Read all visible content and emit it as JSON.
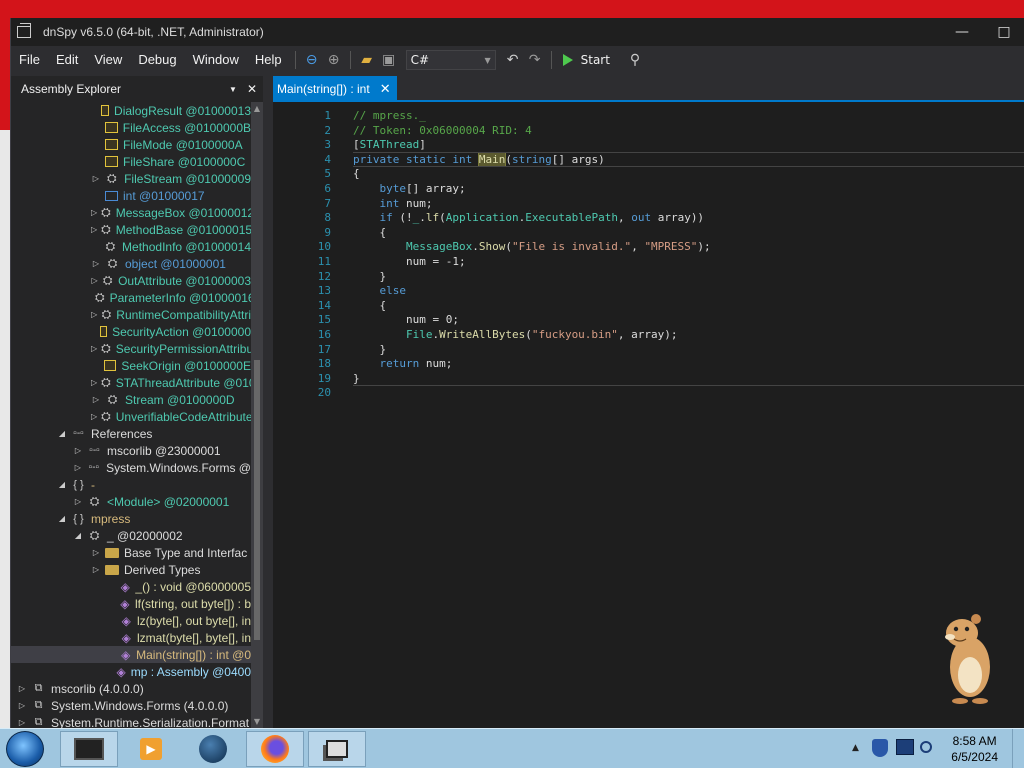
{
  "window": {
    "title": "dnSpy v6.5.0 (64-bit, .NET, Administrator)",
    "minimize_glyph": "—",
    "maximize_glyph": "□"
  },
  "menu": {
    "items": [
      "File",
      "Edit",
      "View",
      "Debug",
      "Window",
      "Help"
    ]
  },
  "toolbar": {
    "language": "C#",
    "start_label": "Start"
  },
  "explorer": {
    "title": "Assembly Explorer",
    "nodes": [
      {
        "text": "DialogResult @01000013",
        "kind": "enum",
        "indent": 3,
        "expander": "",
        "style": "type"
      },
      {
        "text": "FileAccess @0100000B",
        "kind": "enum",
        "indent": 3,
        "expander": "",
        "style": "type"
      },
      {
        "text": "FileMode @0100000A",
        "kind": "enum",
        "indent": 3,
        "expander": "",
        "style": "type"
      },
      {
        "text": "FileShare @0100000C",
        "kind": "enum",
        "indent": 3,
        "expander": "",
        "style": "type"
      },
      {
        "text": "FileStream @01000009",
        "kind": "class",
        "indent": 3,
        "expander": "▷",
        "style": "type"
      },
      {
        "text": "int @01000017",
        "kind": "struct",
        "indent": 3,
        "expander": "",
        "style": "kw"
      },
      {
        "text": "MessageBox @01000012",
        "kind": "class",
        "indent": 3,
        "expander": "▷",
        "style": "type"
      },
      {
        "text": "MethodBase @01000015",
        "kind": "class",
        "indent": 3,
        "expander": "▷",
        "style": "type"
      },
      {
        "text": "MethodInfo @01000014",
        "kind": "class",
        "indent": 3,
        "expander": "",
        "style": "type"
      },
      {
        "text": "object @01000001",
        "kind": "class",
        "indent": 3,
        "expander": "▷",
        "style": "kw"
      },
      {
        "text": "OutAttribute @01000003",
        "kind": "class",
        "indent": 3,
        "expander": "▷",
        "style": "type"
      },
      {
        "text": "ParameterInfo @01000016",
        "kind": "class",
        "indent": 3,
        "expander": "",
        "style": "type"
      },
      {
        "text": "RuntimeCompatibilityAttri",
        "kind": "class",
        "indent": 3,
        "expander": "▷",
        "style": "type"
      },
      {
        "text": "SecurityAction @0100000",
        "kind": "enum",
        "indent": 3,
        "expander": "",
        "style": "type"
      },
      {
        "text": "SecurityPermissionAttribu",
        "kind": "class",
        "indent": 3,
        "expander": "▷",
        "style": "type"
      },
      {
        "text": "SeekOrigin @0100000E",
        "kind": "enum",
        "indent": 3,
        "expander": "",
        "style": "type"
      },
      {
        "text": "STAThreadAttribute @010",
        "kind": "class",
        "indent": 3,
        "expander": "▷",
        "style": "type"
      },
      {
        "text": "Stream @0100000D",
        "kind": "class",
        "indent": 3,
        "expander": "▷",
        "style": "type"
      },
      {
        "text": "UnverifiableCodeAttribute",
        "kind": "class",
        "indent": 3,
        "expander": "▷",
        "style": "type"
      },
      {
        "text": "References",
        "kind": "ref",
        "indent": 1,
        "expander": "◢",
        "style": "plain"
      },
      {
        "text": "mscorlib @23000001",
        "kind": "ref",
        "indent": 2,
        "expander": "▷",
        "style": "plain"
      },
      {
        "text": "System.Windows.Forms @",
        "kind": "ref",
        "indent": 2,
        "expander": "▷",
        "style": "plain"
      },
      {
        "text": "-",
        "kind": "ns",
        "indent": 1,
        "expander": "◢",
        "style": "ns"
      },
      {
        "text": "<Module> @02000001",
        "kind": "class",
        "indent": 2,
        "expander": "▷",
        "style": "type"
      },
      {
        "text": "mpress",
        "kind": "ns",
        "indent": 1,
        "expander": "◢",
        "style": "ns"
      },
      {
        "text": "_ @02000002",
        "kind": "class",
        "indent": 2,
        "expander": "◢",
        "style": "plain"
      },
      {
        "text": "Base Type and Interfac",
        "kind": "folder",
        "indent": 3,
        "expander": "▷",
        "style": "plain"
      },
      {
        "text": "Derived Types",
        "kind": "folder",
        "indent": 3,
        "expander": "▷",
        "style": "plain"
      },
      {
        "text": "_() : void @06000005",
        "kind": "method",
        "indent": 4,
        "expander": "",
        "style": "method"
      },
      {
        "text": "lf(string, out byte[]) : b",
        "kind": "method",
        "indent": 4,
        "expander": "",
        "style": "method"
      },
      {
        "text": "lz(byte[], out byte[], in",
        "kind": "method",
        "indent": 4,
        "expander": "",
        "style": "method"
      },
      {
        "text": "lzmat(byte[], byte[], in",
        "kind": "method",
        "indent": 4,
        "expander": "",
        "style": "method"
      },
      {
        "text": "Main(string[]) : int @0",
        "kind": "method",
        "indent": 4,
        "expander": "",
        "style": "sel"
      },
      {
        "text": "mp : Assembly @0400",
        "kind": "field",
        "indent": 4,
        "expander": "",
        "style": "field"
      },
      {
        "text": "mscorlib (4.0.0.0)",
        "kind": "asm",
        "indent": 0,
        "expander": "▷",
        "style": "plain"
      },
      {
        "text": "System.Windows.Forms (4.0.0.0)",
        "kind": "asm",
        "indent": 0,
        "expander": "▷",
        "style": "plain"
      },
      {
        "text": "System.Runtime.Serialization.Format",
        "kind": "asm",
        "indent": 0,
        "expander": "▷",
        "style": "plain"
      }
    ]
  },
  "tab": {
    "label": "Main(string[]) : int",
    "close": "✕"
  },
  "code": {
    "lines": [
      [
        {
          "t": "// mpress._",
          "c": "com"
        }
      ],
      [
        {
          "t": "// Token: 0x06000004 RID: 4",
          "c": "com"
        }
      ],
      [
        {
          "t": "[",
          "c": ""
        },
        {
          "t": "STAThread",
          "c": "type"
        },
        {
          "t": "]",
          "c": ""
        }
      ],
      [
        {
          "t": "private static int ",
          "c": "kw"
        },
        {
          "t": "Main",
          "c": "hl"
        },
        {
          "t": "(",
          "c": ""
        },
        {
          "t": "string",
          "c": "kw"
        },
        {
          "t": "[] args)",
          "c": ""
        }
      ],
      [
        {
          "t": "{",
          "c": ""
        }
      ],
      [
        {
          "t": "    ",
          "c": ""
        },
        {
          "t": "byte",
          "c": "kw"
        },
        {
          "t": "[] array;",
          "c": ""
        }
      ],
      [
        {
          "t": "    ",
          "c": ""
        },
        {
          "t": "int",
          "c": "kw"
        },
        {
          "t": " num;",
          "c": ""
        }
      ],
      [
        {
          "t": "    ",
          "c": ""
        },
        {
          "t": "if",
          "c": "kw"
        },
        {
          "t": " (!",
          "c": ""
        },
        {
          "t": "_",
          "c": "type"
        },
        {
          "t": ".",
          "c": ""
        },
        {
          "t": "lf",
          "c": "method"
        },
        {
          "t": "(",
          "c": ""
        },
        {
          "t": "Application",
          "c": "type"
        },
        {
          "t": ".",
          "c": ""
        },
        {
          "t": "ExecutablePath",
          "c": "type"
        },
        {
          "t": ", ",
          "c": ""
        },
        {
          "t": "out",
          "c": "kw"
        },
        {
          "t": " array))",
          "c": ""
        }
      ],
      [
        {
          "t": "    {",
          "c": ""
        }
      ],
      [
        {
          "t": "        ",
          "c": ""
        },
        {
          "t": "MessageBox",
          "c": "type"
        },
        {
          "t": ".",
          "c": ""
        },
        {
          "t": "Show",
          "c": "method"
        },
        {
          "t": "(",
          "c": ""
        },
        {
          "t": "\"File is invalid.\"",
          "c": "str"
        },
        {
          "t": ", ",
          "c": ""
        },
        {
          "t": "\"MPRESS\"",
          "c": "str"
        },
        {
          "t": ");",
          "c": ""
        }
      ],
      [
        {
          "t": "        num = -1;",
          "c": ""
        }
      ],
      [
        {
          "t": "    }",
          "c": ""
        }
      ],
      [
        {
          "t": "    ",
          "c": ""
        },
        {
          "t": "else",
          "c": "kw"
        }
      ],
      [
        {
          "t": "    {",
          "c": ""
        }
      ],
      [
        {
          "t": "        num = 0;",
          "c": ""
        }
      ],
      [
        {
          "t": "        ",
          "c": ""
        },
        {
          "t": "File",
          "c": "type"
        },
        {
          "t": ".",
          "c": ""
        },
        {
          "t": "WriteAllBytes",
          "c": "method"
        },
        {
          "t": "(",
          "c": ""
        },
        {
          "t": "\"fuckyou.bin\"",
          "c": "str"
        },
        {
          "t": ", array);",
          "c": ""
        }
      ],
      [
        {
          "t": "    }",
          "c": ""
        }
      ],
      [
        {
          "t": "    ",
          "c": ""
        },
        {
          "t": "return",
          "c": "kw"
        },
        {
          "t": " num;",
          "c": ""
        }
      ],
      [
        {
          "t": "}",
          "c": ""
        }
      ],
      [
        {
          "t": "",
          "c": ""
        }
      ]
    ]
  },
  "taskbar": {
    "time": "8:58 AM",
    "date": "6/5/2024"
  },
  "colors": {
    "accent": "#007acc",
    "desktop": "#d3141a",
    "taskbar": "#9fc6df"
  }
}
